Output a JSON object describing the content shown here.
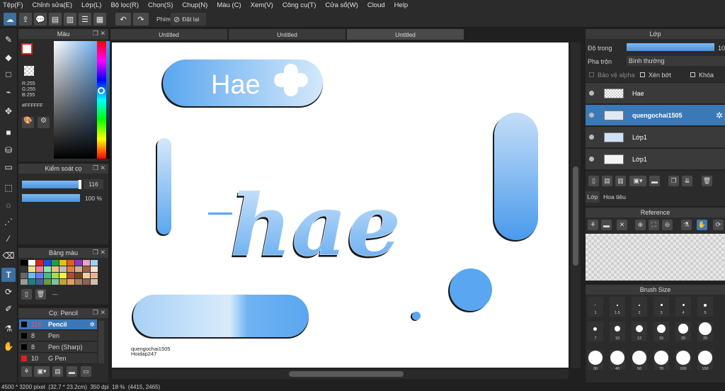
{
  "menu": [
    "Tệp(F)",
    "Chỉnh sửa(E)",
    "Lớp(L)",
    "Bộ lọc(R)",
    "Chọn(S)",
    "Chụp(N)",
    "Màu (C)",
    "Xem(V)",
    "Công cụ(T)",
    "Cửa sổ(W)",
    "Cloud",
    "Help"
  ],
  "toolbar": {
    "snap_label": "Phím",
    "reset_label": "Đặt lại"
  },
  "tabs": [
    "Untitled",
    "Untitled",
    "Untitled"
  ],
  "color_panel": {
    "title": "Màu",
    "r": "R:255",
    "g": "G:255",
    "b": "B:255",
    "hex": "#FFFFFF"
  },
  "brush_control": {
    "title": "Kiểm soát cọ",
    "size": "116",
    "opacity": "100 %"
  },
  "palette": {
    "title": "Bảng màu",
    "name": "---"
  },
  "brush_list": {
    "title": "Cọ: Pencil",
    "items": [
      {
        "size": "116",
        "name": "Pencil"
      },
      {
        "size": "8",
        "name": "Pen"
      },
      {
        "size": "8",
        "name": "Pen (Sharp)"
      },
      {
        "size": "10",
        "name": "G Pen"
      }
    ]
  },
  "canvas": {
    "main_text": "hae",
    "pill_text": "Hae",
    "sig1": "quengochai1505",
    "sig2": "Hoidap247"
  },
  "layer_panel": {
    "title": "Lớp",
    "opacity_label": "Độ trong",
    "opacity_value": "10",
    "blend_label": "Pha trộn",
    "blend_value": "Bình thường",
    "protect_alpha": "Bảo vệ alpha",
    "clip": "Xén bớt",
    "lock": "Khóa",
    "layers": [
      "Hae",
      "quengochai1505",
      "Lớp1",
      "Lớp1"
    ],
    "tab_layer": "Lớp",
    "tab_nav": "Hoa tiêu"
  },
  "reference": {
    "title": "Reference"
  },
  "brush_size": {
    "title": "Brush Size",
    "sizes": [
      "1",
      "1.5",
      "2",
      "3",
      "4",
      "5",
      "7",
      "10",
      "12",
      "15",
      "20",
      "25",
      "30",
      "40",
      "50",
      "70",
      "100",
      "150"
    ]
  },
  "status": {
    "dims": "4500 * 3200 pixel",
    "cm": "(32.7 * 23.2cm)",
    "dpi": "350 dpi",
    "zoom": "18 %",
    "coords": "(4415, 2465)"
  },
  "colors": {
    "accent": "#3b78b8",
    "ui_bg": "#2b2b2b",
    "canvas": "#ffffff",
    "blue": "#5aa6f0"
  }
}
